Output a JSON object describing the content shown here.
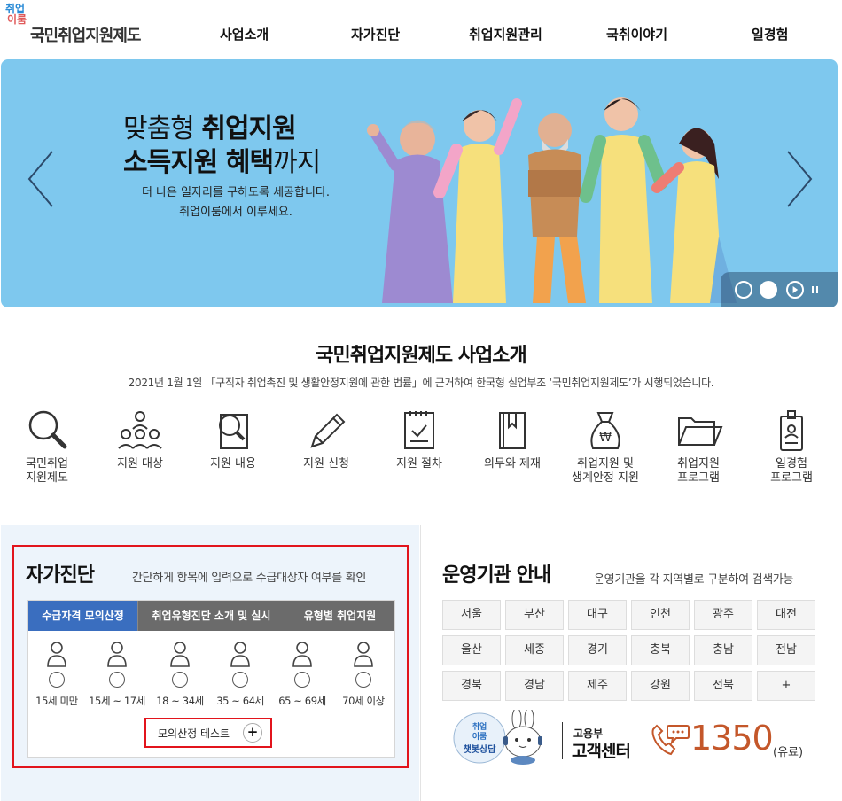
{
  "logo": {
    "mark_top": "취업",
    "mark_bottom": "이룸",
    "name": "국민취업지원제도"
  },
  "nav": [
    "사업소개",
    "자가진단",
    "취업지원관리",
    "국취이야기",
    "일경험"
  ],
  "hero": {
    "line1_plain": "맞춤형 ",
    "line1_bold": "취업지원",
    "line2_bold": "소득지원 혜택",
    "line2_plain": "까지",
    "sub1": "더 나은 일자리를 구하도록 세공합니다.",
    "sub2": "취업이룸에서 이루세요."
  },
  "intro": {
    "title": "국민취업지원제도 사업소개",
    "desc": "2021년 1월 1일 「구직자 취업촉진 및 생활안정지원에 관한 법률」에 근거하여 한국형 실업부조 ‘국민취업지원제도’가 시행되었습니다."
  },
  "icons": [
    {
      "line1": "국민취업",
      "line2": "지원제도",
      "icon": "magnifier-icon"
    },
    {
      "line1": "지원 대상",
      "line2": "",
      "icon": "people-icon"
    },
    {
      "line1": "지원 내용",
      "line2": "",
      "icon": "document-search-icon"
    },
    {
      "line1": "지원 신청",
      "line2": "",
      "icon": "pencil-icon"
    },
    {
      "line1": "지원 절차",
      "line2": "",
      "icon": "checklist-icon"
    },
    {
      "line1": "의무와 제재",
      "line2": "",
      "icon": "book-icon"
    },
    {
      "line1": "취업지원 및",
      "line2": "생계안정 지원",
      "icon": "money-bag-icon"
    },
    {
      "line1": "취업지원",
      "line2": "프로그램",
      "icon": "folder-icon"
    },
    {
      "line1": "일경험",
      "line2": "프로그램",
      "icon": "id-badge-icon"
    }
  ],
  "diagnosis": {
    "title": "자가진단",
    "desc": "간단하게 항목에 입력으로 수급대상자 여부를 확인",
    "tabs": [
      "수급자격 모의산정",
      "취업유형진단 소개 및 실시",
      "유형별 취업지원"
    ],
    "ages": [
      "15세 미만",
      "15세 ~ 17세",
      "18 ~ 34세",
      "35 ~ 64세",
      "65 ~ 69세",
      "70세 이상"
    ],
    "mock_button": "모의산정 테스트",
    "plus": "+"
  },
  "org": {
    "title": "운영기관 안내",
    "desc": "운영기관을 각 지역별로 구분하여 검색가능",
    "regions": [
      "서울",
      "부산",
      "대구",
      "인천",
      "광주",
      "대전",
      "울산",
      "세종",
      "경기",
      "충북",
      "충남",
      "전남",
      "경북",
      "경남",
      "제주",
      "강원",
      "전북",
      "+"
    ]
  },
  "support": {
    "chatbot_top": "취업",
    "chatbot_mid": "이룸",
    "chatbot_label": "챗봇상담",
    "org": "고용부",
    "name": "고객센터",
    "phone": "1350",
    "note": "(유료)"
  },
  "colors": {
    "hero_bg": "#7ec8ee",
    "tab_active": "#3a6ebf",
    "highlight": "#e2141c",
    "phone": "#c4572a"
  }
}
